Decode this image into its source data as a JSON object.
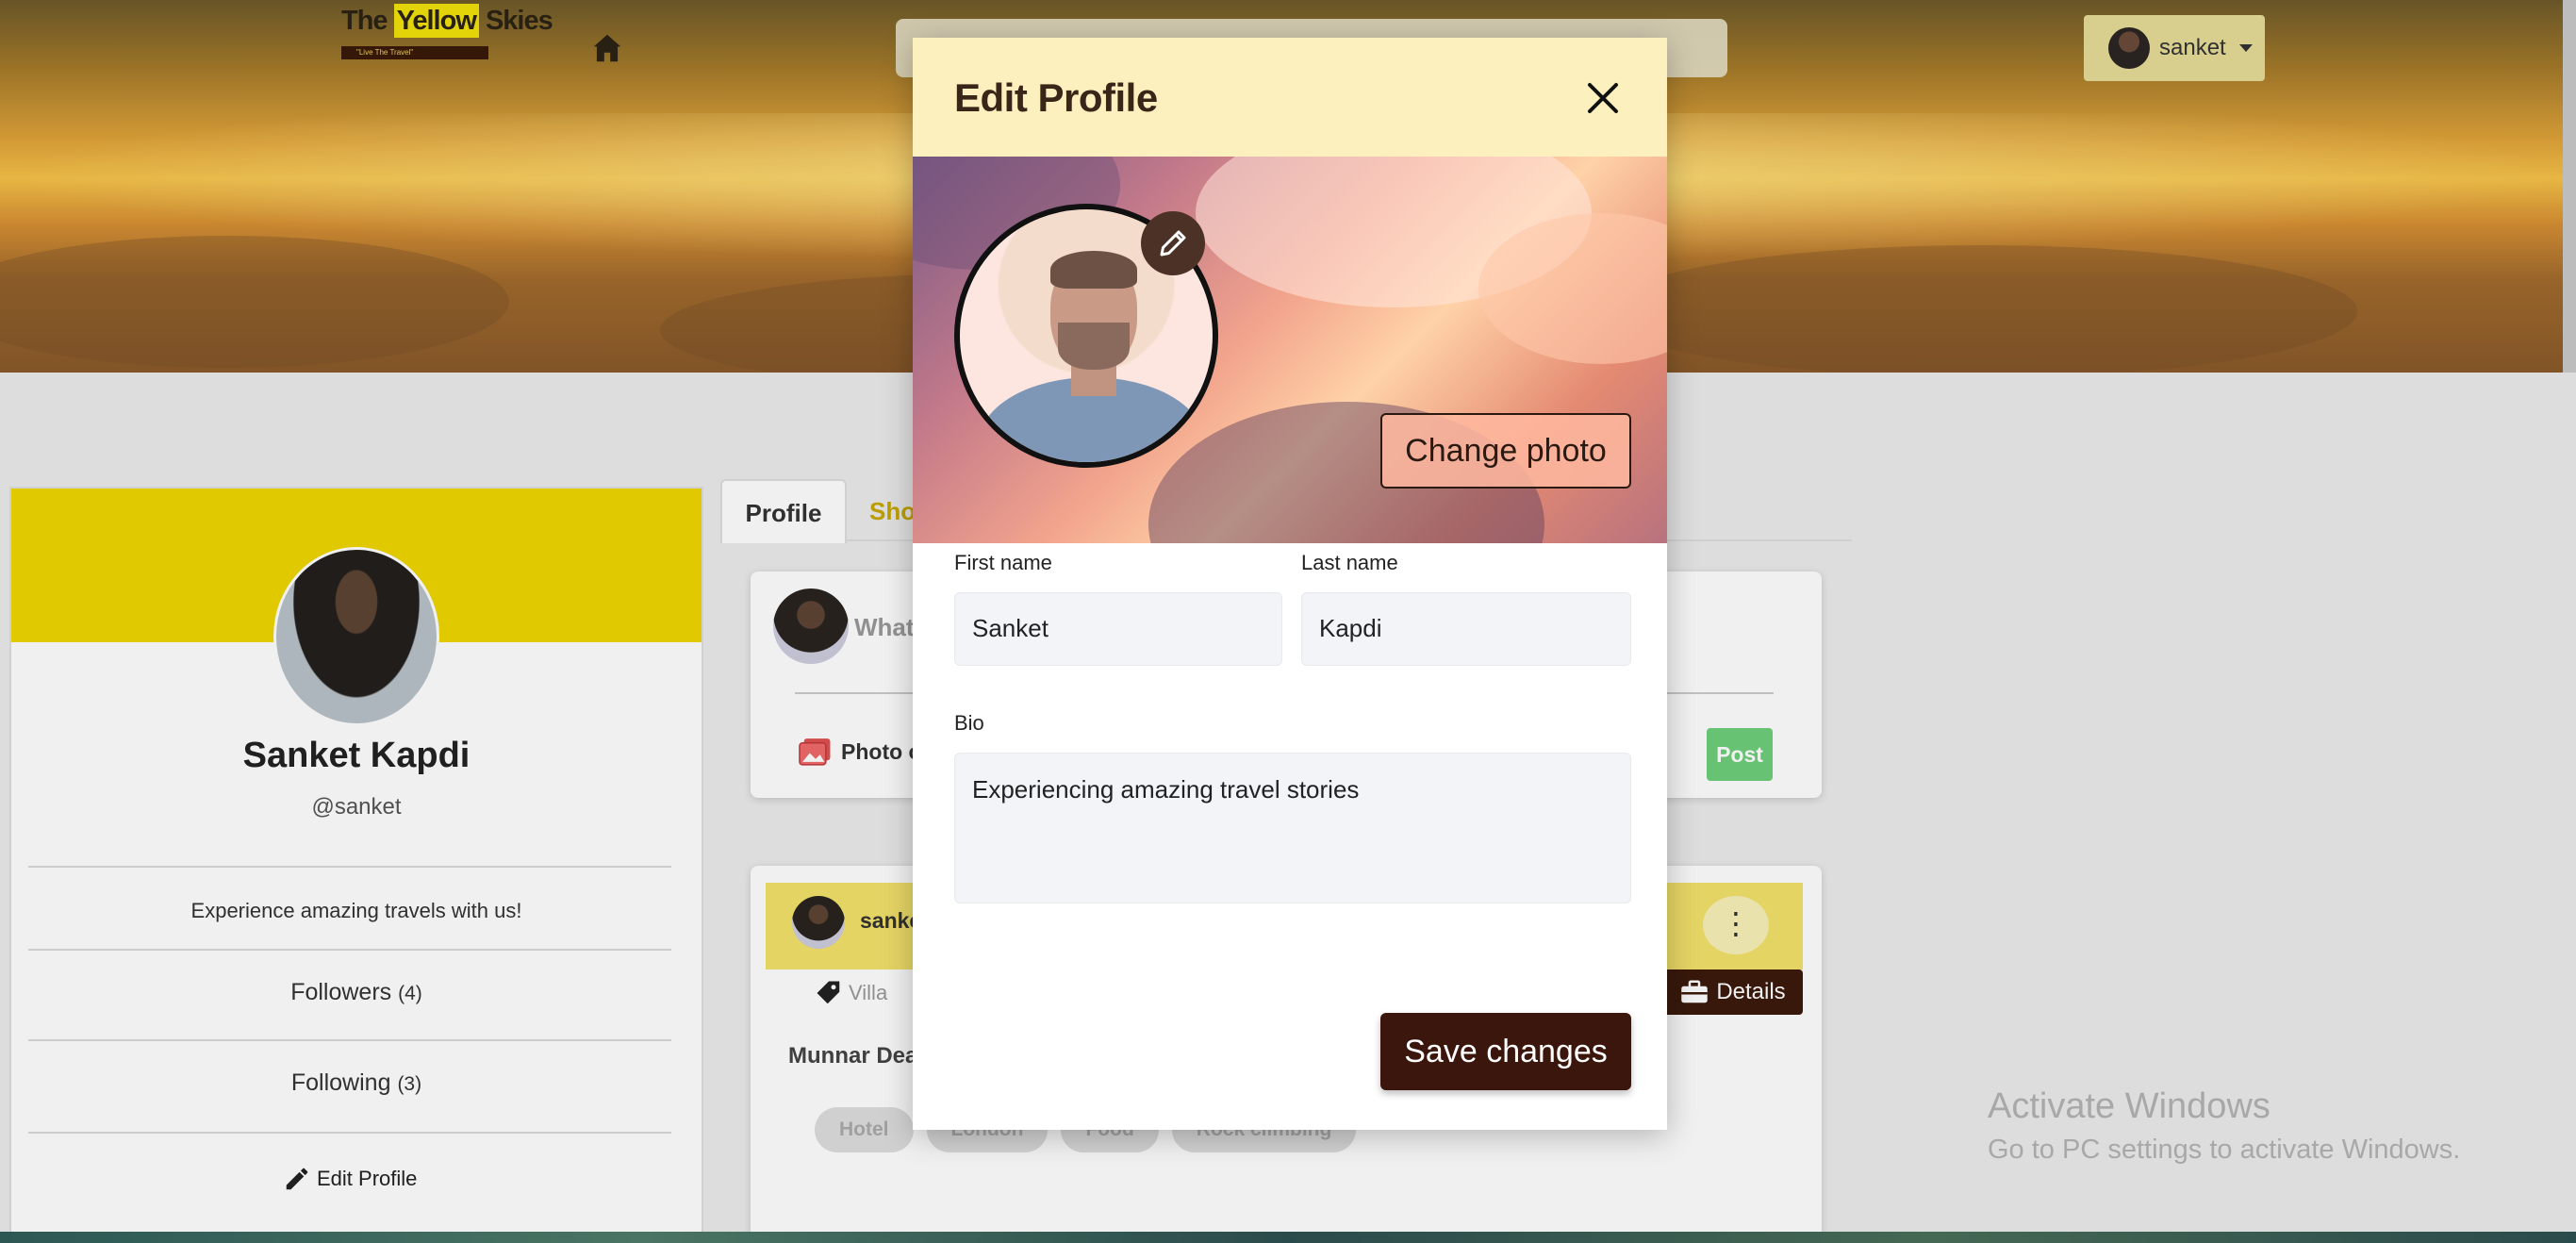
{
  "header": {
    "logo": {
      "word1": "The",
      "word2": "Yellow",
      "word3": "Skies",
      "tagline": "\"Live The Travel\""
    },
    "icons": {
      "home": "home-icon"
    },
    "user_menu": {
      "username": "sanket"
    }
  },
  "profile_card": {
    "name": "Sanket Kapdi",
    "handle": "@sanket",
    "bio": "Experience amazing travels with us!",
    "followers_label": "Followers",
    "followers_count": "(4)",
    "following_label": "Following",
    "following_count": "(3)",
    "edit_label": "Edit Profile"
  },
  "tabs": [
    {
      "label": "Profile"
    },
    {
      "label": "Sho"
    }
  ],
  "post_box": {
    "placeholder": "What",
    "photo_label": "Photo o",
    "post_label": "Post"
  },
  "feed_item": {
    "user": "sanke",
    "tag": "Villa",
    "details_label": "Details",
    "title": "Munnar Dea",
    "chips": [
      "Hotel",
      "London",
      "Food",
      "Rock climbing"
    ]
  },
  "modal": {
    "title": "Edit Profile",
    "change_photo_label": "Change photo",
    "first_name_label": "First name",
    "first_name_value": "Sanket",
    "last_name_label": "Last name",
    "last_name_value": "Kapdi",
    "bio_label": "Bio",
    "bio_value": "Experiencing amazing travel stories",
    "save_label": "Save changes"
  },
  "watermark": {
    "line1": "Activate Windows",
    "line2": "Go to PC settings to activate Windows."
  },
  "colors": {
    "accent_yellow": "#f0d600",
    "modal_header": "#fcf1be",
    "save_button": "#3b160c",
    "post_button": "#6fcf7c"
  }
}
